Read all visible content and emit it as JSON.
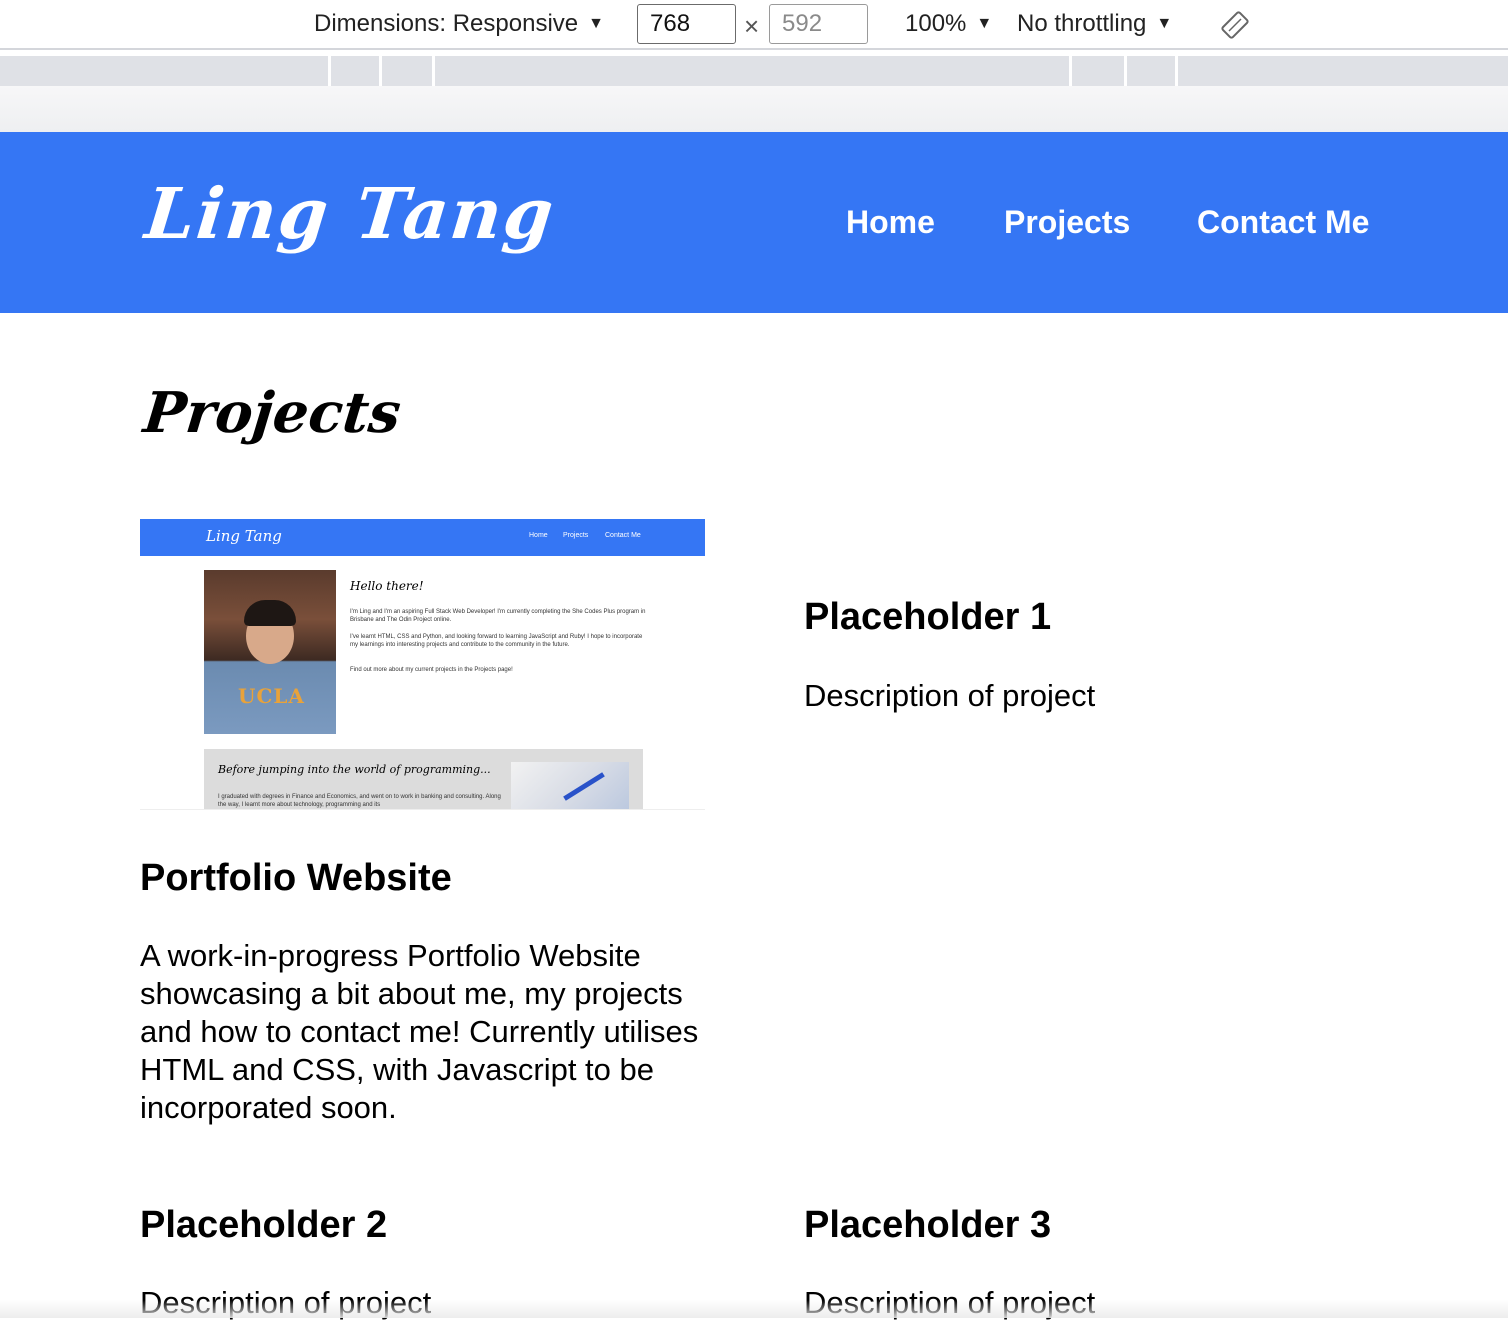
{
  "devtools": {
    "dimensions_label": "Dimensions: Responsive",
    "width_value": "768",
    "height_value": "592",
    "times": "×",
    "zoom": "100%",
    "throttling": "No throttling",
    "caret": "▼"
  },
  "site": {
    "logo": "Ling Tang",
    "nav": [
      "Home",
      "Projects",
      "Contact Me"
    ],
    "accent_color": "#3576f4"
  },
  "page": {
    "title": "Projects"
  },
  "thumbnail": {
    "logo": "Ling Tang",
    "nav": [
      "Home",
      "Projects",
      "Contact Me"
    ],
    "hello": "Hello there!",
    "para1": "I'm Ling and I'm an aspiring Full Stack Web Developer! I'm currently completing the She Codes Plus program in Brisbane and The Odin Project online.",
    "para2": "I've learnt HTML, CSS and Python, and looking forward to learning JavaScript and Ruby! I hope to incorporate my learnings into interesting projects and contribute to the community in the future.",
    "para3": "Find out more about my current projects in the Projects page!",
    "card_title": "Before jumping into the world of programming...",
    "card_text": "I graduated with degrees in Finance and Economics, and went on to work in banking and consulting. Along the way, I learnt more about technology, programming and its",
    "shirt_text": "UCLA"
  },
  "projects": [
    {
      "title": "Placeholder 1",
      "description": "Description of project"
    },
    {
      "title": "Portfolio Website",
      "description": "A work-in-progress Portfolio Website showcasing a bit about me, my projects and how to contact me! Currently utilises HTML and CSS, with Javascript to be incorporated soon."
    },
    {
      "title": "Placeholder 2",
      "description": "Description of project"
    },
    {
      "title": "Placeholder 3",
      "description": "Description of project"
    }
  ]
}
